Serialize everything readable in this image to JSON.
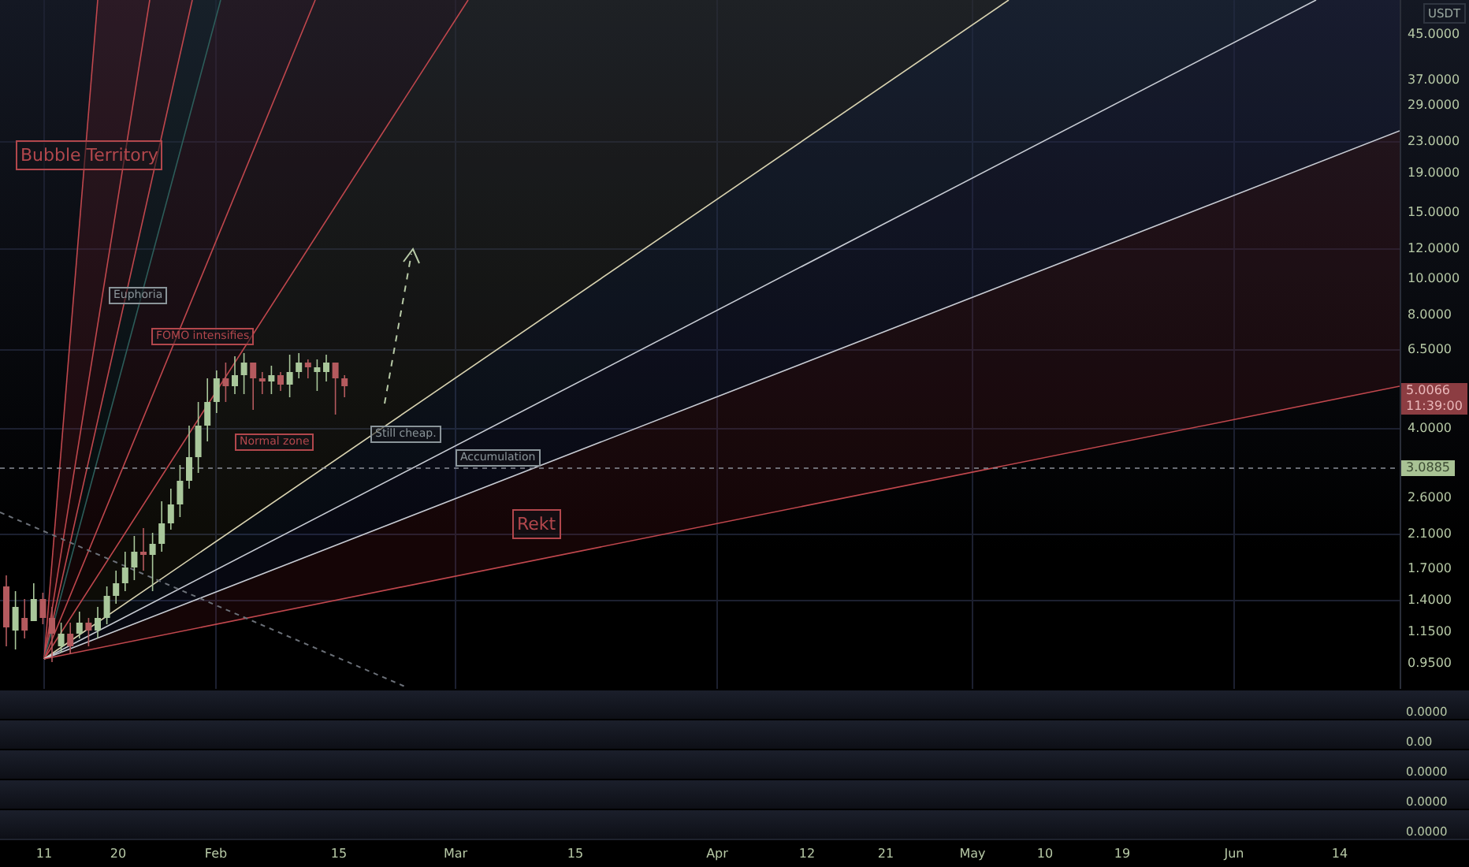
{
  "price_axis": {
    "currency": "USDT",
    "ticks": [
      "45.0000",
      "37.0000",
      "29.0000",
      "23.0000",
      "19.0000",
      "15.0000",
      "12.0000",
      "10.0000",
      "8.0000",
      "6.5000",
      "4.0000",
      "2.6000",
      "2.1000",
      "1.7000",
      "1.4000",
      "1.1500",
      "0.9500"
    ]
  },
  "price_tags": [
    {
      "kind": "last",
      "lines": [
        "5.0066",
        "11:39:00"
      ]
    },
    {
      "kind": "crosshair",
      "lines": [
        "3.0885"
      ]
    }
  ],
  "annotations": [
    {
      "text": "Bubble Territory",
      "color": "#b2474c"
    },
    {
      "text": "Euphoria",
      "color": "#8a9499"
    },
    {
      "text": "FOMO intensifies",
      "color": "#b2474c"
    },
    {
      "text": "Normal zone",
      "color": "#b2474c"
    },
    {
      "text": "Still cheap.",
      "color": "#8a9499"
    },
    {
      "text": "Accumulation",
      "color": "#8a9499"
    },
    {
      "text": "Rekt",
      "color": "#b2474c"
    }
  ],
  "panes": [
    {
      "value": "0.0000"
    },
    {
      "value": "0.00"
    },
    {
      "value": "0.0000"
    },
    {
      "value": "0.0000"
    },
    {
      "value": "0.0000"
    }
  ],
  "time_axis": [
    "11",
    "20",
    "Feb",
    "15",
    "Mar",
    "15",
    "Apr",
    "12",
    "21",
    "May",
    "10",
    "19",
    "Jun",
    "14"
  ]
}
